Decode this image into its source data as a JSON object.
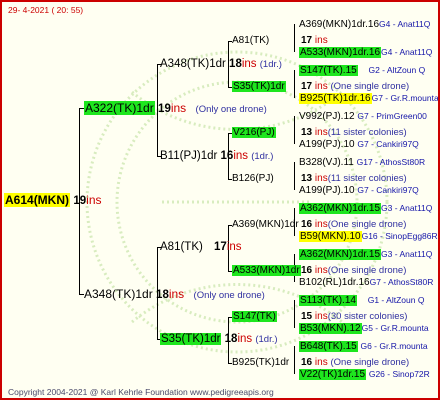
{
  "stamp": "29-  4-2021 ( 20: 55)",
  "copyright": "Copyright 2004-2021 @ Karl Kehrle Foundation   www.pedigreeapis.org",
  "root": {
    "id": "A614(MKN)",
    "num": "19",
    "ins": "ins"
  },
  "g1": {
    "top": {
      "id": "A322(TK)1dr",
      "num": "19",
      "ins": "ins",
      "note": "(Only one drone)"
    },
    "bot": {
      "id": "A348(TK)1dr",
      "num": "18",
      "ins": "ins",
      "note": "(Only one drone)"
    }
  },
  "g2": {
    "a": {
      "id": "A348(TK)1dr",
      "num": "18",
      "ins": "ins",
      "note": "(1dr.)"
    },
    "b": {
      "id": "B11(PJ)1dr",
      "num": "16",
      "ins": "ins",
      "note": "(1dr.)"
    },
    "c": {
      "id": "A81(TK)",
      "num": "17",
      "ins": "ins"
    },
    "d": {
      "id": "S35(TK)1dr",
      "num": "18",
      "ins": "ins",
      "note": "(1dr.)"
    }
  },
  "g3": {
    "a1": {
      "id": "A81(TK)",
      "num": "17",
      "ins": "ins"
    },
    "a2": {
      "id": "S35(TK)1dr",
      "num": "17",
      "ins": "ins",
      "note": "(One single drone)"
    },
    "b1": {
      "id": "V216(PJ)",
      "num": "13",
      "ins": "ins",
      "note": "(11 sister colonies)"
    },
    "b2": {
      "id": "B126(PJ)",
      "num": "13",
      "ins": "ins",
      "note": "(11 sister colonies)"
    },
    "c1": {
      "id": "A369(MKN)1dr",
      "num": "16",
      "ins": "ins",
      "note": "(One single drone)"
    },
    "c2": {
      "id": "A533(MKN)1dr",
      "num": "16",
      "ins": "ins",
      "note": "(One single drone)"
    },
    "d1": {
      "id": "S147(TK)",
      "num": "15",
      "ins": "ins",
      "note": "(30 sister colonies)"
    },
    "d2": {
      "id": "B925(TK)1dr",
      "num": "16",
      "ins": "ins",
      "note": "(One single drone)"
    }
  },
  "g4": [
    {
      "id": "A369(MKN)1dr.16",
      "tail": "G4 - Anat11Q"
    },
    {
      "id": "A533(MKN)1dr.16",
      "tail": "G4 - Anat11Q"
    },
    {
      "id": "S147(TK).15",
      "tail": "G2 - AltZoun Q"
    },
    {
      "id": "B925(TK)1dr.16",
      "tail": "G7 - Gr.R.mounta"
    },
    {
      "id": "V992(PJ).12",
      "tail": "G7 - PrimGreen00"
    },
    {
      "id": "A199(PJ).10",
      "tail": "G7 - Cankiri97Q"
    },
    {
      "id": "B328(VJ).11",
      "tail": "G17 - AthosSt80R"
    },
    {
      "id": "A199(PJ).10",
      "tail": "G7 - Cankiri97Q"
    },
    {
      "id": "A362(MKN)1dr.15",
      "tail": "G3 - Anat11Q"
    },
    {
      "id": "B59(MKN).10",
      "tail": "G16 - SinopEgg86R"
    },
    {
      "id": "A362(MKN)1dr.15",
      "tail": "G3 - Anat11Q"
    },
    {
      "id": "B102(RL)1dr.16",
      "tail": "G7 - AthosSt80R"
    },
    {
      "id": "S113(TK).14",
      "tail": "G1 - AltZoun Q"
    },
    {
      "id": "B53(MKN).12",
      "tail": "G5 - Gr.R.mounta"
    },
    {
      "id": "B648(TK).15",
      "tail": "G6 - Gr.R.mounta"
    },
    {
      "id": "V22(TK)1dr.15",
      "tail": "G26 - Sinop72R"
    }
  ],
  "watermark": "pedigreeapis.org"
}
